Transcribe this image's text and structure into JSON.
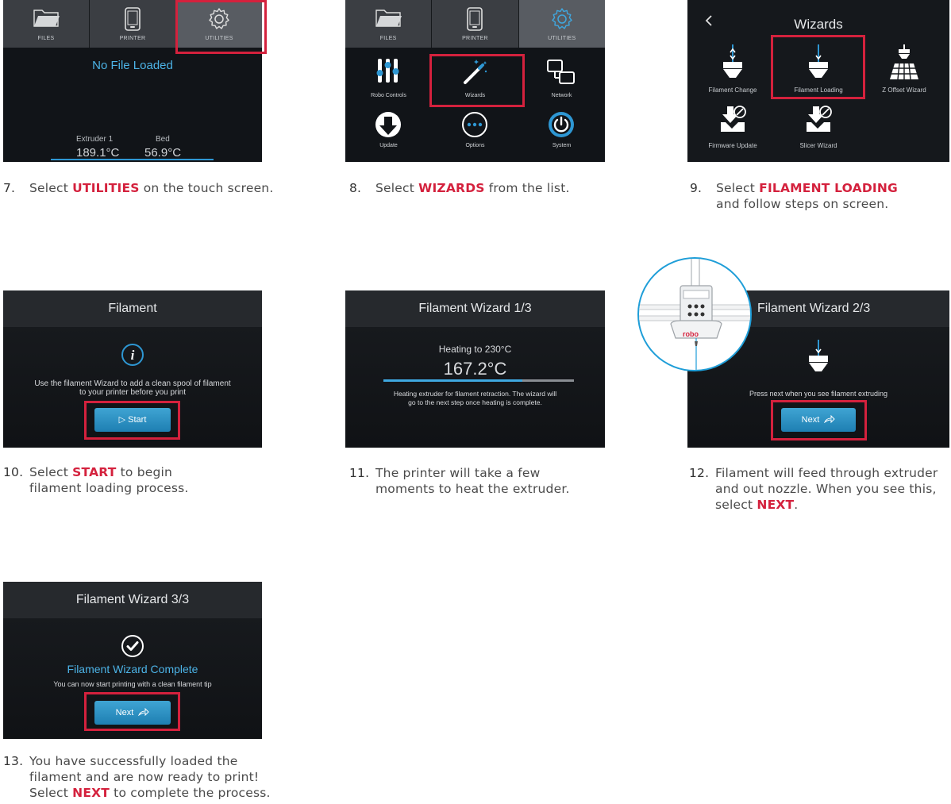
{
  "colors": {
    "accent_red": "#d4213d",
    "screen_bg": "#111418",
    "blue": "#2e97d3"
  },
  "tabs": {
    "files": "FILES",
    "printer": "PRINTER",
    "utilities": "UTILITIES"
  },
  "screen7": {
    "status": "No File Loaded",
    "extruder_label": "Extruder 1",
    "bed_label": "Bed",
    "extruder_temp": "189.1°C",
    "bed_temp": "56.9°C"
  },
  "screen8": {
    "items": [
      "Robo Controls",
      "Wizards",
      "Network",
      "Update",
      "Options",
      "System"
    ]
  },
  "screen9": {
    "title": "Wizards",
    "items": [
      "Filament Change",
      "Filament Loading",
      "Z Offset Wizard",
      "Firmware Update",
      "Slicer Wizard"
    ]
  },
  "screen10": {
    "title": "Filament",
    "message_line1": "Use the filament Wizard to add a clean spool of filament",
    "message_line2": "to your printer before you print",
    "button": "▷ Start"
  },
  "screen11": {
    "title": "Filament Wizard 1/3",
    "heating_label": "Heating to 230°C",
    "temp": "167.2°C",
    "progress": 0.73,
    "note_line1": "Heating extruder for filament retraction. The wizard will",
    "note_line2": "go to the next step once heating is complete."
  },
  "screen12": {
    "title": "Filament Wizard 2/3",
    "message": "Press next when you see filament extruding",
    "button": "Next",
    "logo": "robo"
  },
  "screen13": {
    "title": "Filament Wizard 3/3",
    "headline": "Filament Wizard Complete",
    "message": "You can now start printing with a clean filament tip",
    "button": "Next"
  },
  "steps": [
    {
      "num": "7.",
      "pre": "Select ",
      "kw": "UTILITIES",
      "post": " on the touch screen."
    },
    {
      "num": "8.",
      "pre": "Select ",
      "kw": "WIZARDS",
      "post": " from the list."
    },
    {
      "num": "9.",
      "pre": "Select ",
      "kw": "FILAMENT LOADING",
      "post": "",
      "line2": "and follow steps on screen."
    },
    {
      "num": "10.",
      "pre": "Select ",
      "kw": "START",
      "post": " to begin",
      "line2": "filament loading process."
    },
    {
      "num": "11.",
      "line1": "The printer will take a few",
      "line2": "moments to heat the extruder."
    },
    {
      "num": "12.",
      "line1": "Filament will feed through extruder",
      "line2": "and out nozzle. When you see this,",
      "pre3": "select ",
      "kw3": "NEXT",
      "post3": "."
    },
    {
      "num": "13.",
      "line1": "You have successfully loaded the",
      "line2": "filament and are now ready to print!",
      "pre3": "Select ",
      "kw3": "NEXT",
      "post3": " to complete the process."
    }
  ]
}
